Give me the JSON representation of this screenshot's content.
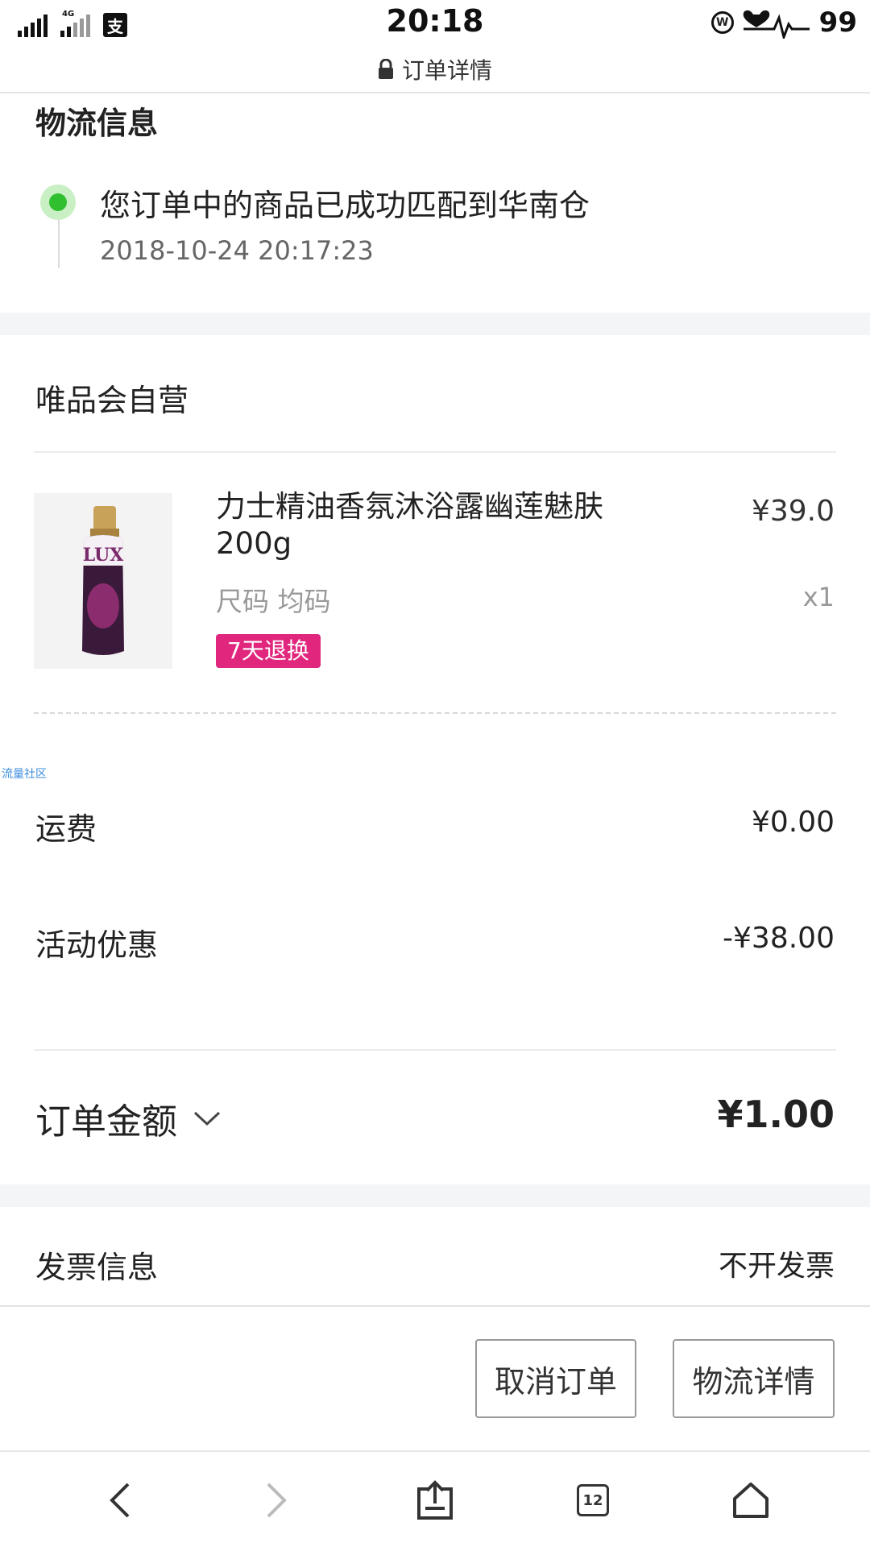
{
  "status_bar": {
    "network_label": "4G",
    "app_icon_glyph": "支",
    "time": "20:18",
    "battery": "99"
  },
  "url_bar": {
    "title": "订单详情"
  },
  "logistics": {
    "section_title": "物流信息",
    "message": "您订单中的商品已成功匹配到华南仓",
    "timestamp": "2018-10-24 20:17:23",
    "status_color": "#2fbf2f"
  },
  "store": {
    "name": "唯品会自营"
  },
  "product": {
    "title": "力士精油香氛沐浴露幽莲魅肤200g",
    "price": "¥39.0",
    "spec": "尺码 均码",
    "quantity": "x1",
    "return_badge": "7天退换",
    "badge_color": "#e0267d",
    "image_brand": "LUX"
  },
  "watermark": "流量社区",
  "fees": {
    "shipping_label": "运费",
    "shipping_value": "¥0.00",
    "discount_label": "活动优惠",
    "discount_value": "-¥38.00",
    "total_label": "订单金额",
    "total_value": "¥1.00"
  },
  "invoice": {
    "label": "发票信息",
    "value": "不开发票"
  },
  "actions": {
    "cancel_label": "取消订单",
    "logistics_label": "物流详情"
  },
  "toolbar": {
    "tabs_count": "12"
  }
}
